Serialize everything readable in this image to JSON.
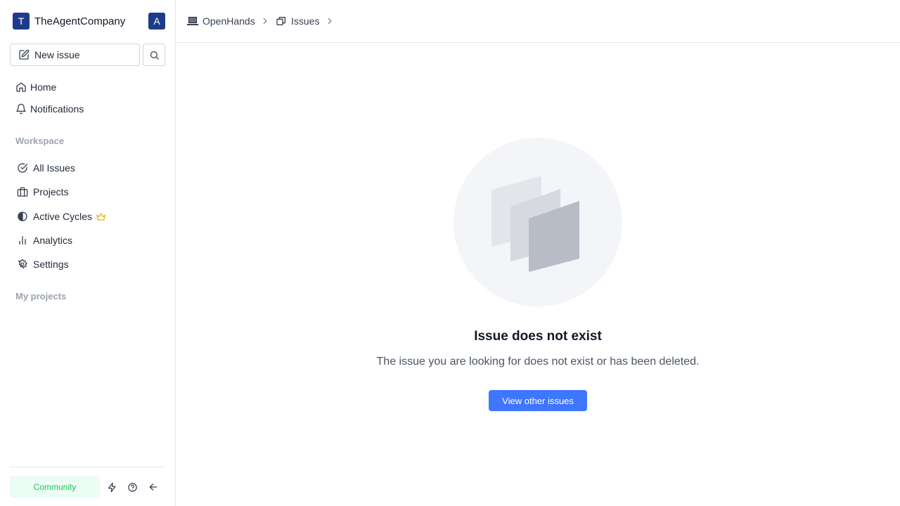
{
  "workspace": {
    "logo_letter": "T",
    "name": "TheAgentCompany",
    "user_initial": "A"
  },
  "sidebar": {
    "new_issue_label": "New issue",
    "top_items": [
      {
        "label": "Home",
        "icon": "home-icon"
      },
      {
        "label": "Notifications",
        "icon": "bell-icon"
      }
    ],
    "workspace_section_label": "Workspace",
    "workspace_items": [
      {
        "label": "All Issues",
        "icon": "check-circle-icon"
      },
      {
        "label": "Projects",
        "icon": "briefcase-icon"
      },
      {
        "label": "Active Cycles",
        "icon": "contrast-icon",
        "badge_icon": "crown-icon"
      },
      {
        "label": "Analytics",
        "icon": "bar-chart-icon"
      },
      {
        "label": "Settings",
        "icon": "gear-icon"
      }
    ],
    "projects_section_label": "My projects",
    "footer": {
      "community_label": "Community",
      "icons": [
        "zap-icon",
        "help-circle-icon",
        "arrow-left-icon"
      ]
    }
  },
  "breadcrumb": [
    {
      "label": "OpenHands",
      "icon": "laptop-icon"
    },
    {
      "label": "Issues",
      "icon": "layers-icon"
    }
  ],
  "empty_state": {
    "title": "Issue does not exist",
    "description": "The issue you are looking for does not exist or has been deleted.",
    "button_label": "View other issues"
  },
  "colors": {
    "brand": "#1e3a8a",
    "primary": "#3f76ff",
    "community_bg": "#ecfdf3",
    "community_text": "#22c55e",
    "crown": "#eab308"
  }
}
